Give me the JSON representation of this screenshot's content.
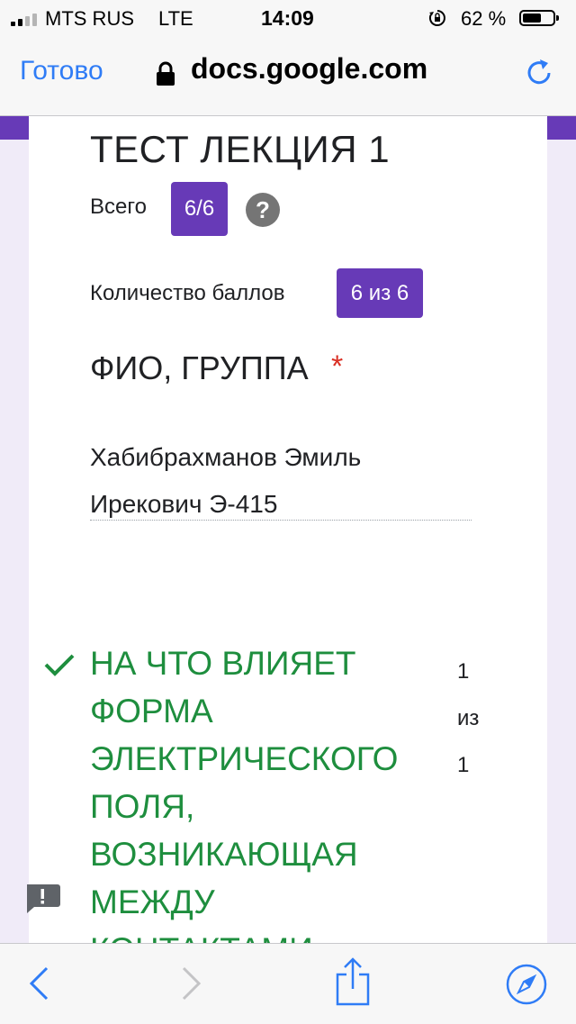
{
  "status_bar": {
    "carrier": "MTS RUS",
    "network": "LTE",
    "time": "14:09",
    "battery_percent": "62 %",
    "battery_level": 0.62,
    "signal_bars": 2
  },
  "nav_bar": {
    "done_label": "Готово",
    "url": "docs.google.com"
  },
  "colors": {
    "accent": "#673ab7",
    "link_blue": "#2f7cf6",
    "correct_green": "#1e8e3e",
    "required_red": "#d93025"
  },
  "form": {
    "title": "ТЕСТ ЛЕКЦИЯ 1",
    "total_label": "Всего",
    "total_value": "6/6",
    "points_label": "Количество баллов",
    "points_value": "6 из 6",
    "field_label": "ФИО, ГРУППА",
    "required_mark": "*",
    "answer_line1": "Хабибрахманов Эмиль",
    "answer_line2": "Ирекович Э-415",
    "question": {
      "lines": [
        "НА ЧТО ВЛИЯЕТ",
        "ФОРМА",
        "ЭЛЕКТРИЧЕСКОГО",
        "ПОЛЯ,",
        "ВОЗНИКАЮЩАЯ",
        "МЕЖДУ",
        "КОНТАКТАМИ"
      ],
      "score_got": "1",
      "score_sep": "из",
      "score_max": "1"
    }
  },
  "icons": {
    "help": "help-icon",
    "check": "check-icon",
    "feedback": "feedback-icon",
    "back": "chevron-left-icon",
    "forward": "chevron-right-icon",
    "share": "share-icon",
    "safari": "compass-icon"
  }
}
